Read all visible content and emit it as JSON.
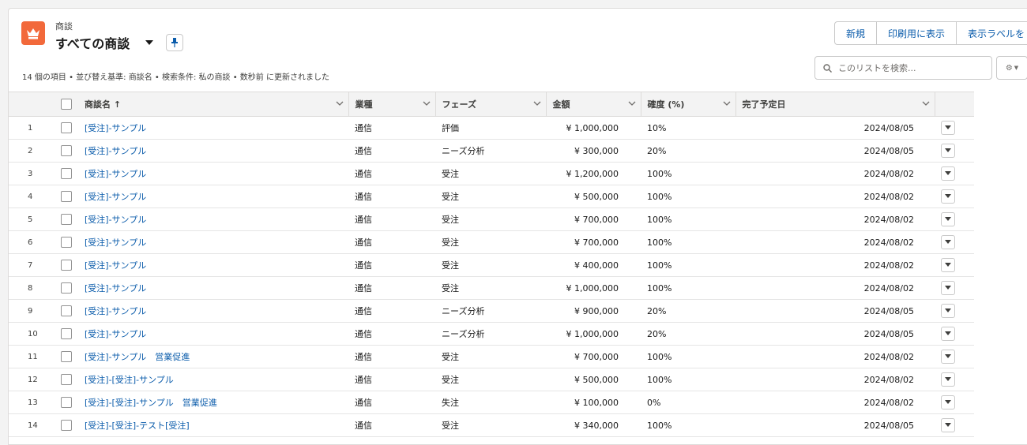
{
  "header": {
    "object_label": "商談",
    "list_title": "すべての商談",
    "meta": "14 個の項目 • 並び替え基準: 商談名 • 検索条件: 私の商談 • 数秒前 に更新されました"
  },
  "buttons": {
    "new": "新規",
    "print": "印刷用に表示",
    "display_label": "表示ラベルを"
  },
  "search": {
    "placeholder": "このリストを検索..."
  },
  "columns": {
    "name": "商談名 ↑",
    "industry": "業種",
    "phase": "フェーズ",
    "amount": "金額",
    "probability": "確度 (%)",
    "close_date": "完了予定日"
  },
  "rows": [
    {
      "n": "1",
      "name": "[受注]-サンプル",
      "industry": "通信",
      "phase": "評価",
      "amount": "¥ 1,000,000",
      "prob": "10%",
      "date": "2024/08/05"
    },
    {
      "n": "2",
      "name": "[受注]-サンプル",
      "industry": "通信",
      "phase": "ニーズ分析",
      "amount": "¥ 300,000",
      "prob": "20%",
      "date": "2024/08/05"
    },
    {
      "n": "3",
      "name": "[受注]-サンプル",
      "industry": "通信",
      "phase": "受注",
      "amount": "¥ 1,200,000",
      "prob": "100%",
      "date": "2024/08/02"
    },
    {
      "n": "4",
      "name": "[受注]-サンプル",
      "industry": "通信",
      "phase": "受注",
      "amount": "¥ 500,000",
      "prob": "100%",
      "date": "2024/08/02"
    },
    {
      "n": "5",
      "name": "[受注]-サンプル",
      "industry": "通信",
      "phase": "受注",
      "amount": "¥ 700,000",
      "prob": "100%",
      "date": "2024/08/02"
    },
    {
      "n": "6",
      "name": "[受注]-サンプル",
      "industry": "通信",
      "phase": "受注",
      "amount": "¥ 700,000",
      "prob": "100%",
      "date": "2024/08/02"
    },
    {
      "n": "7",
      "name": "[受注]-サンプル",
      "industry": "通信",
      "phase": "受注",
      "amount": "¥ 400,000",
      "prob": "100%",
      "date": "2024/08/02"
    },
    {
      "n": "8",
      "name": "[受注]-サンプル",
      "industry": "通信",
      "phase": "受注",
      "amount": "¥ 1,000,000",
      "prob": "100%",
      "date": "2024/08/02"
    },
    {
      "n": "9",
      "name": "[受注]-サンプル",
      "industry": "通信",
      "phase": "ニーズ分析",
      "amount": "¥ 900,000",
      "prob": "20%",
      "date": "2024/08/05"
    },
    {
      "n": "10",
      "name": "[受注]-サンプル",
      "industry": "通信",
      "phase": "ニーズ分析",
      "amount": "¥ 1,000,000",
      "prob": "20%",
      "date": "2024/08/05"
    },
    {
      "n": "11",
      "name": "[受注]-サンプル　営業促進",
      "industry": "通信",
      "phase": "受注",
      "amount": "¥ 700,000",
      "prob": "100%",
      "date": "2024/08/02"
    },
    {
      "n": "12",
      "name": "[受注]-[受注]-サンプル",
      "industry": "通信",
      "phase": "受注",
      "amount": "¥ 500,000",
      "prob": "100%",
      "date": "2024/08/02"
    },
    {
      "n": "13",
      "name": "[受注]-[受注]-サンプル　営業促進",
      "industry": "通信",
      "phase": "失注",
      "amount": "¥ 100,000",
      "prob": "0%",
      "date": "2024/08/02"
    },
    {
      "n": "14",
      "name": "[受注]-[受注]-テスト[受注]",
      "industry": "通信",
      "phase": "受注",
      "amount": "¥ 340,000",
      "prob": "100%",
      "date": "2024/08/05"
    }
  ],
  "colors": {
    "accent": "#0b5cab",
    "icon_bg": "#f2693b"
  }
}
